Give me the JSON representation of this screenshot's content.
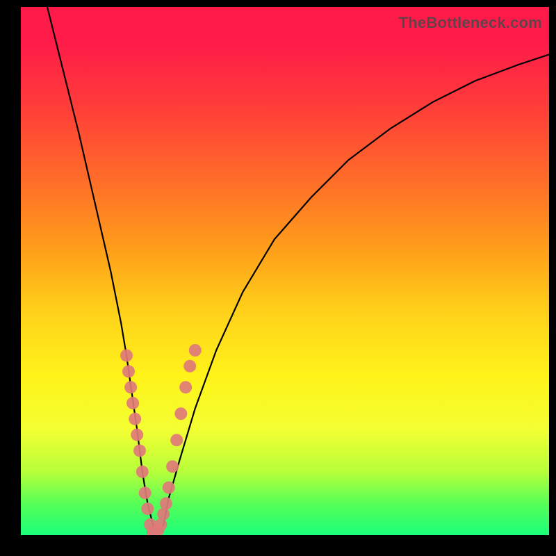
{
  "watermark": "TheBottleneck.com",
  "chart_data": {
    "type": "line",
    "title": "",
    "xlabel": "",
    "ylabel": "",
    "xlim": [
      0,
      100
    ],
    "ylim": [
      0,
      100
    ],
    "grid": false,
    "legend": false,
    "series": [
      {
        "name": "bottleneck-curve",
        "x": [
          5,
          8,
          11,
          14,
          17,
          19,
          20,
          21,
          22,
          23,
          24,
          25,
          26,
          27,
          28,
          30,
          33,
          37,
          42,
          48,
          55,
          62,
          70,
          78,
          86,
          94,
          100
        ],
        "y": [
          100,
          88,
          76,
          63,
          50,
          40,
          34,
          27,
          20,
          12,
          6,
          2,
          0,
          2,
          7,
          14,
          24,
          35,
          46,
          56,
          64,
          71,
          77,
          82,
          86,
          89,
          91
        ]
      }
    ],
    "points": [
      {
        "name": "left-cluster",
        "xy": [
          [
            20.0,
            34
          ],
          [
            20.4,
            31
          ],
          [
            20.8,
            28
          ],
          [
            21.2,
            25
          ],
          [
            21.6,
            22
          ],
          [
            22.0,
            19
          ],
          [
            22.5,
            16
          ],
          [
            23.0,
            12
          ],
          [
            23.5,
            8
          ],
          [
            24.0,
            5
          ],
          [
            24.5,
            2
          ],
          [
            25.0,
            0.5
          ]
        ]
      },
      {
        "name": "right-cluster",
        "xy": [
          [
            25.5,
            0.5
          ],
          [
            26.0,
            1
          ],
          [
            26.5,
            2
          ],
          [
            27.0,
            4
          ],
          [
            27.5,
            6
          ],
          [
            28.0,
            9
          ],
          [
            28.7,
            13
          ],
          [
            29.5,
            18
          ],
          [
            30.3,
            23
          ],
          [
            31.2,
            28
          ],
          [
            32.0,
            32
          ],
          [
            33.0,
            35
          ]
        ]
      }
    ],
    "background_gradient": {
      "top": "#ff1a4a",
      "mid": "#fff31a",
      "bottom": "#1aff7a"
    }
  }
}
